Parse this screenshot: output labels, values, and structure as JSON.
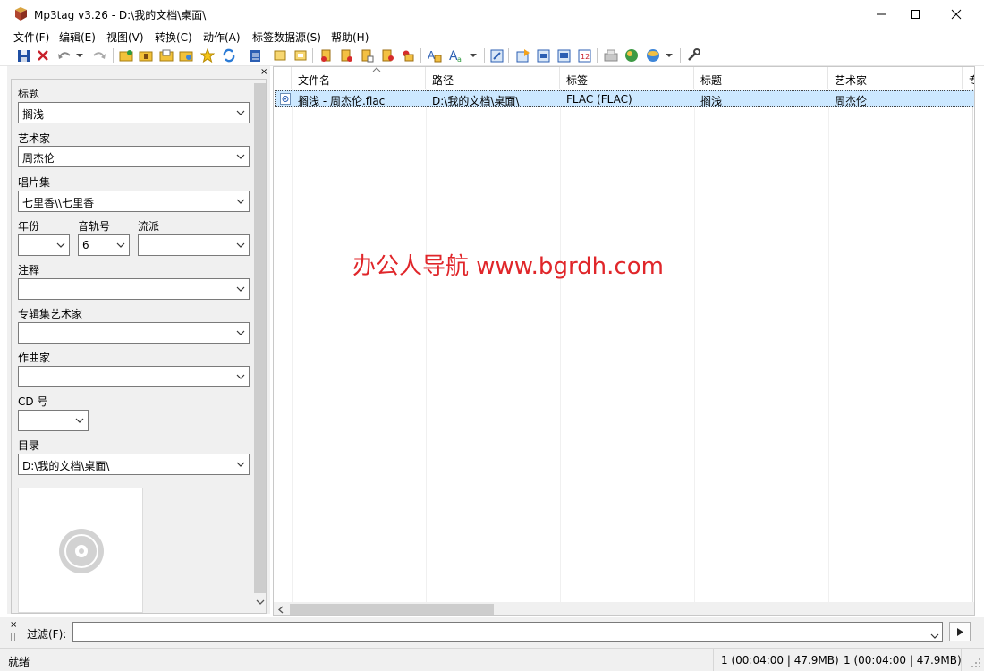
{
  "window": {
    "title": "Mp3tag v3.26  -  D:\\我的文档\\桌面\\"
  },
  "menu": [
    "文件(F)",
    "编辑(E)",
    "视图(V)",
    "转换(C)",
    "动作(A)",
    "标签数据源(S)",
    "帮助(H)"
  ],
  "toolbar_icons": [
    "save-icon",
    "delete-icon",
    "undo-icon",
    "redo-icon",
    "add-folder-icon",
    "add-files-icon",
    "playlist-icon",
    "open-icon",
    "favorite-icon",
    "refresh-icon",
    "text-file-icon",
    "cut-icon",
    "copy-icon",
    "tag-filename-icon",
    "filename-tag-icon",
    "text-tag-icon",
    "tag-tag-icon",
    "case-convert-icon",
    "actions-icon",
    "edit-icon",
    "export-icon",
    "autonumber-icon",
    "freedb-icon",
    "ffmpeg-icon",
    "web-sources-icon",
    "options-icon"
  ],
  "tag_panel": {
    "title": {
      "label": "标题",
      "value": "搁浅"
    },
    "artist": {
      "label": "艺术家",
      "value": "周杰伦"
    },
    "album": {
      "label": "唱片集",
      "value": "七里香\\\\七里香"
    },
    "year": {
      "label": "年份",
      "value": ""
    },
    "track": {
      "label": "音轨号",
      "value": "6"
    },
    "genre": {
      "label": "流派",
      "value": ""
    },
    "comment": {
      "label": "注释",
      "value": ""
    },
    "album_artist": {
      "label": "专辑集艺术家",
      "value": ""
    },
    "composer": {
      "label": "作曲家",
      "value": ""
    },
    "disc": {
      "label": "CD 号",
      "value": ""
    },
    "directory": {
      "label": "目录",
      "value": "D:\\我的文档\\桌面\\"
    }
  },
  "file_list": {
    "columns": [
      "文件名",
      "路径",
      "标签",
      "标题",
      "艺术家",
      "专"
    ],
    "rows": [
      {
        "filename": "搁浅 - 周杰伦.flac",
        "path": "D:\\我的文档\\桌面\\",
        "tag": "FLAC (FLAC)",
        "title": "搁浅",
        "artist": "周杰伦"
      }
    ]
  },
  "watermark": "办公人导航  www.bgrdh.com",
  "filter": {
    "label": "过滤(F):",
    "value": ""
  },
  "status": {
    "ready": "就绪",
    "selected": "1 (00:04:00 | 47.9MB)",
    "total": "1 (00:04:00 | 47.9MB)"
  }
}
